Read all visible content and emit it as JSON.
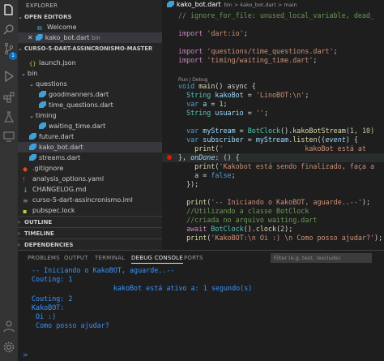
{
  "sidebar": {
    "title": "EXPLORER",
    "open_editors_label": "OPEN EDITORS",
    "open_editors": [
      {
        "name": "Welcome"
      },
      {
        "name": "kako_bot.dart",
        "path": "bin"
      }
    ],
    "project_label": "CURSO-5-DART-ASSINCRONISMO-MASTER",
    "tree": {
      "launch": "launch.json",
      "bin": "bin",
      "questions": "questions",
      "goodmanners": "goodmanners.dart",
      "time_questions": "time_questions.dart",
      "timing": "timing",
      "waiting_time": "waiting_time.dart",
      "future": "future.dart",
      "kako_bot": "kako_bot.dart",
      "streams": "streams.dart",
      "gitignore": ".gitignore",
      "analysis": "analysis_options.yaml",
      "changelog": "CHANGELOG.md",
      "iml": "curso-5-dart-assincronismo.iml",
      "pubspec": "pubspec.lock"
    },
    "outline": "OUTLINE",
    "timeline": "TIMELINE",
    "dependencies": "DEPENDENCIES"
  },
  "editor": {
    "tab": "kako_bot.dart",
    "breadcrumb": "bin > kako_bot.dart > main",
    "codelens": "Run | Debug",
    "lines": {
      "l1": "// ignore_for_file: unused_local_variable, dead_",
      "l2_kw": "import",
      "l2_str": "'dart:io'",
      "l3_kw": "import",
      "l3_str": "'questions/time_questions.dart'",
      "l4_kw": "import",
      "l4_str": "'timing/waiting_time.dart'",
      "main_void": "void",
      "main_fn": "main",
      "main_rest": "() async {",
      "s1_type": "String",
      "s1_var": "kakoBot",
      "s1_str": "'LinoBOT:\\n'",
      "v_kw": "var",
      "v_var": "a",
      "v_num": "1",
      "s2_type": "String",
      "s2_var": "usuario",
      "s2_str": "''",
      "ms_kw": "var",
      "ms_var": "myStream",
      "ms_cls": "BotClock",
      "ms_fn": "kakoBotStream",
      "ms_args": "(1, 10)",
      "sub_kw": "var",
      "sub_var": "subscriber",
      "sub_obj": "myStream",
      "sub_fn": "listen",
      "sub_param": "event",
      "print1_fn": "print",
      "print1_str": "'                    kakoBot está at",
      "ondone_pre": "}, ",
      "ondone_name": "onDone",
      "ondone_rest": ": () {",
      "print2_fn": "print",
      "print2_str": "'Kakobot está sendo finalizado, faça a",
      "aset_var": "a",
      "aset_kw": "false",
      "close": "});",
      "print3_fn": "print",
      "print3_str": "'-- Iniciando o KakoBOT, aguarde..--'",
      "c1": "//Utilizando a classe BotClock",
      "c2": "//criada no arquivo waiting.dart",
      "aw_kw": "await",
      "aw_cls": "BotClock",
      "aw_fn": "clock",
      "aw_num": "2",
      "print4_fn": "print",
      "print4_str": "'KakoBOT:\\n Oi :) \\n Como posso ajudar?'"
    }
  },
  "panel": {
    "tabs": [
      "PROBLEMS",
      "OUTPUT",
      "TERMINAL",
      "DEBUG CONSOLE",
      "PORTS"
    ],
    "active_tab": "DEBUG CONSOLE",
    "filter_placeholder": "Filter (e.g. text, !exclude)",
    "output": [
      "-- Iniciando o KakoBOT, aguarde..--",
      "Couting: 1",
      "                    kakoBot está ativo a: 1 segundo(s)",
      "Couting: 2",
      "KakoBOT:",
      " Oi :)",
      " Como posso ajudar?"
    ],
    "prompt": ">"
  },
  "colors": {
    "accent": "#0e70c0",
    "console_text": "#3794ff"
  }
}
